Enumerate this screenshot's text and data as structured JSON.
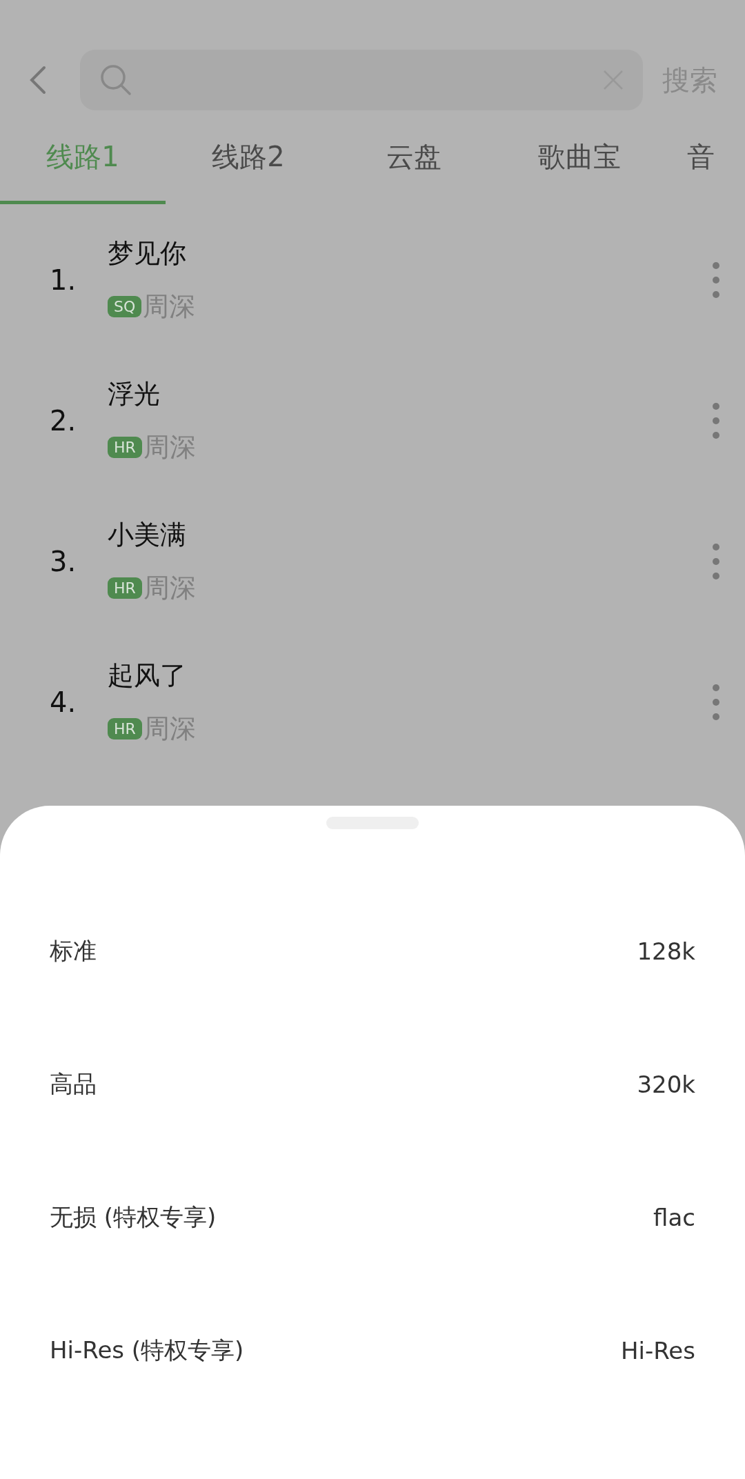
{
  "search": {
    "action": "搜索"
  },
  "tabs": [
    {
      "label": "线路1",
      "selected": true
    },
    {
      "label": "线路2",
      "selected": false
    },
    {
      "label": "云盘",
      "selected": false
    },
    {
      "label": "歌曲宝",
      "selected": false
    },
    {
      "label": "音",
      "selected": false
    }
  ],
  "songs": [
    {
      "index": "1.",
      "title": "梦见你",
      "badge": "SQ",
      "artist": "周深"
    },
    {
      "index": "2.",
      "title": "浮光",
      "badge": "HR",
      "artist": "周深"
    },
    {
      "index": "3.",
      "title": "小美满",
      "badge": "HR",
      "artist": "周深"
    },
    {
      "index": "4.",
      "title": "起风了",
      "badge": "HR",
      "artist": "周深"
    }
  ],
  "quality_sheet": {
    "options": [
      {
        "label": "标准",
        "format": "128k"
      },
      {
        "label": "高品",
        "format": "320k"
      },
      {
        "label": "无损 (特权专享)",
        "format": "flac"
      },
      {
        "label": "Hi-Res (特权专享)",
        "format": "Hi-Res"
      }
    ]
  }
}
